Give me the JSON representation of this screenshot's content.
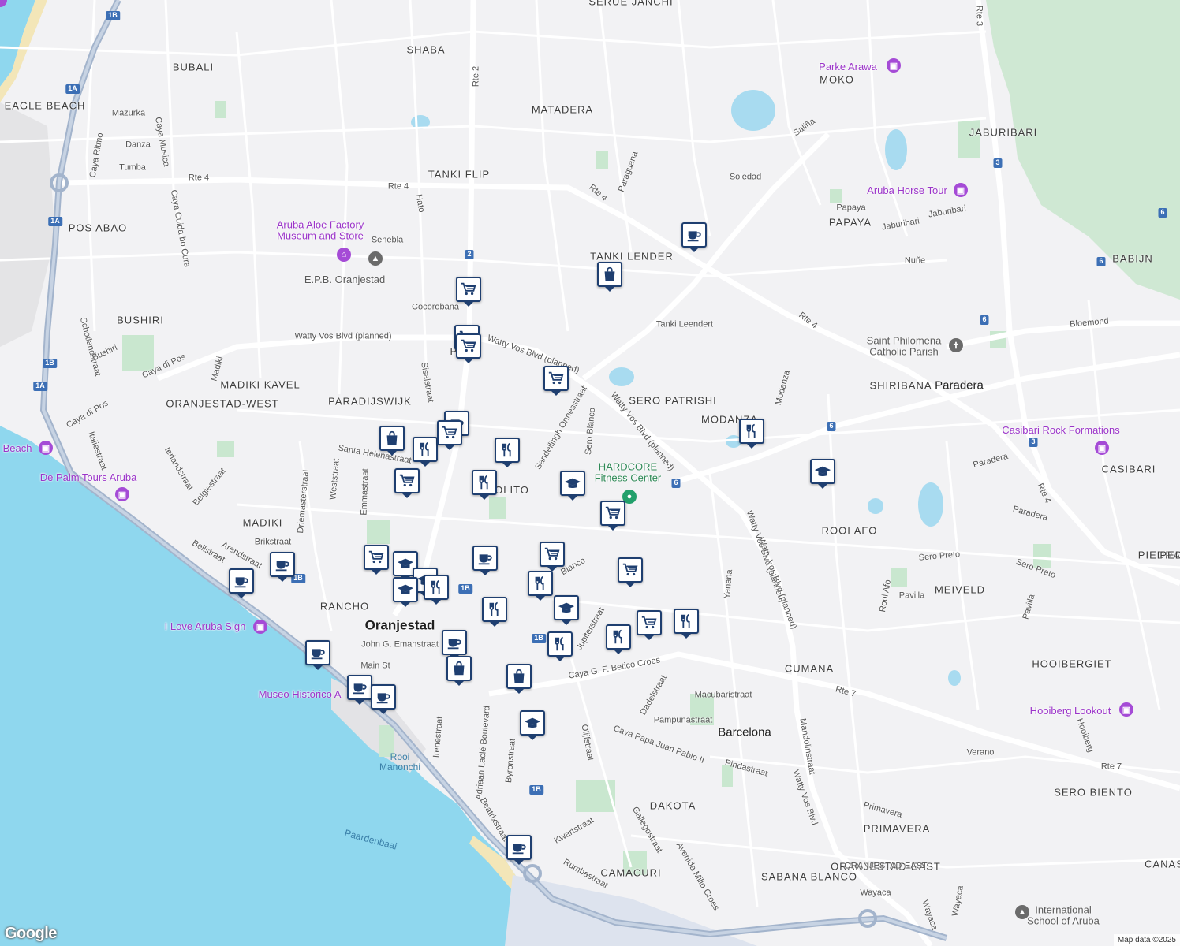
{
  "areas": [
    {
      "id": "shaba",
      "text": "SHABA"
    },
    {
      "id": "bubali",
      "text": "BUBALI"
    },
    {
      "id": "eagle-beach",
      "text": "EAGLE BEACH"
    },
    {
      "id": "matadera",
      "text": "MATADERA"
    },
    {
      "id": "moko",
      "text": "MOKO"
    },
    {
      "id": "jaburibari",
      "text": "JABURIBARI"
    },
    {
      "id": "tanki-flip",
      "text": "TANKI FLIP"
    },
    {
      "id": "pos-abao",
      "text": "POS ABAO"
    },
    {
      "id": "papaya",
      "text": "PAPAYA"
    },
    {
      "id": "tanki-lender",
      "text": "TANKI LENDER"
    },
    {
      "id": "babijn",
      "text": "BABIJN"
    },
    {
      "id": "bushiri",
      "text": "BUSHIRI"
    },
    {
      "id": "shiribana",
      "text": "SHIRIBANA"
    },
    {
      "id": "madiki-kavel",
      "text": "MADIKI KAVEL"
    },
    {
      "id": "paradijswijk",
      "text": "PARADIJSWIJK"
    },
    {
      "id": "sero-patrishi",
      "text": "SERO PATRISHI"
    },
    {
      "id": "oranjestad-west",
      "text": "ORANJESTAD-WEST"
    },
    {
      "id": "modanza",
      "text": "MODANZA"
    },
    {
      "id": "casibari",
      "text": "CASIBARI"
    },
    {
      "id": "rooi-afo",
      "text": "ROOI AFO"
    },
    {
      "id": "piedra",
      "text": "PIEDRA"
    },
    {
      "id": "madiki",
      "text": "MADIKI"
    },
    {
      "id": "meiveld",
      "text": "MEIVELD"
    },
    {
      "id": "rancho",
      "text": "RANCHO"
    },
    {
      "id": "hooibergiet",
      "text": "HOOIBERGIET"
    },
    {
      "id": "cumana",
      "text": "CUMANA"
    },
    {
      "id": "sero-biento",
      "text": "SERO BIENTO"
    },
    {
      "id": "dakota",
      "text": "DAKOTA"
    },
    {
      "id": "primavera",
      "text": "PRIMAVERA"
    },
    {
      "id": "camacuri",
      "text": "CAMACURI"
    },
    {
      "id": "sabana-blanco",
      "text": "SABANA BLANCO"
    },
    {
      "id": "oranjestad-east",
      "text": "ORANJESTAD-EAST"
    },
    {
      "id": "canas",
      "text": "CANAS"
    },
    {
      "id": "pedro-partial",
      "text": "PEDRO"
    },
    {
      "id": "serue-janchi",
      "text": "SERUE JANCHI"
    }
  ],
  "towns": [
    {
      "id": "oranjestad",
      "text": "Oranjestad"
    },
    {
      "id": "paradera",
      "text": "Paradera"
    },
    {
      "id": "barcelona",
      "text": "Barcelona"
    }
  ],
  "streets": [
    {
      "id": "mazurka",
      "text": "Mazurka"
    },
    {
      "id": "caya-ritmo",
      "text": "Caya Ritmo"
    },
    {
      "id": "caya-musica",
      "text": "Caya Musica"
    },
    {
      "id": "danza",
      "text": "Danza"
    },
    {
      "id": "tumba",
      "text": "Tumba"
    },
    {
      "id": "rte4-west",
      "text": "Rte 4"
    },
    {
      "id": "rte4-mid",
      "text": "Rte 4"
    },
    {
      "id": "rte4-ne",
      "text": "Rte 4"
    },
    {
      "id": "rte4-east",
      "text": "Rte 4"
    },
    {
      "id": "caya-cuida",
      "text": "Caya Cuida bo Cura"
    },
    {
      "id": "rte2",
      "text": "Rte 2"
    },
    {
      "id": "hato",
      "text": "Hato"
    },
    {
      "id": "senebla",
      "text": "Senebla"
    },
    {
      "id": "paraguana",
      "text": "Paraguana"
    },
    {
      "id": "salina",
      "text": "Saliña"
    },
    {
      "id": "soledad",
      "text": "Soledad"
    },
    {
      "id": "papaya-st",
      "text": "Papaya"
    },
    {
      "id": "jaburibari-st",
      "text": "Jaburibari"
    },
    {
      "id": "jaburibari-st2",
      "text": "Jaburibari"
    },
    {
      "id": "nune",
      "text": "Nuñe"
    },
    {
      "id": "rte3",
      "text": "Rte 3"
    },
    {
      "id": "cocorobana",
      "text": "Cocorobana"
    },
    {
      "id": "schotlandstraat",
      "text": "Schotlandstraat"
    },
    {
      "id": "watty-planned-1",
      "text": "Watty Vos Blvd (planned)"
    },
    {
      "id": "watty-planned-2",
      "text": "Watty Vos Blvd (planned)"
    },
    {
      "id": "watty-planned-3",
      "text": "Watty Vos Blvd (planned)"
    },
    {
      "id": "watty-planned-4",
      "text": "Watty Vos Blvd (planned)"
    },
    {
      "id": "tanki-leendert",
      "text": "Tanki Leendert"
    },
    {
      "id": "bloemond",
      "text": "Bloemond"
    },
    {
      "id": "bushiri-st",
      "text": "Bushiri"
    },
    {
      "id": "caya-di-pos",
      "text": "Caya di Pos"
    },
    {
      "id": "caya-di-pos-2",
      "text": "Caya di Pos"
    },
    {
      "id": "madiki-st",
      "text": "Madiki"
    },
    {
      "id": "sisalstraat",
      "text": "Sisalstraat"
    },
    {
      "id": "dellingh",
      "text": "Sandellingh Onnesstraat"
    },
    {
      "id": "sero-blanco-st",
      "text": "Sero Blanco"
    },
    {
      "id": "modanza-st",
      "text": "Modanza"
    },
    {
      "id": "italiestraat",
      "text": "Italiestraat"
    },
    {
      "id": "ierlandstraat",
      "text": "Ierlandstraat"
    },
    {
      "id": "belgiestraat",
      "text": "Belgiestraat"
    },
    {
      "id": "santa-helena",
      "text": "Santa Helenastraat"
    },
    {
      "id": "weststraat",
      "text": "Weststraat"
    },
    {
      "id": "emmastraat",
      "text": "Emmastraat"
    },
    {
      "id": "driemasterstraat",
      "text": "Driemasterstraat"
    },
    {
      "id": "paradera-st",
      "text": "Paradera"
    },
    {
      "id": "paradera-st2",
      "text": "Paradera"
    },
    {
      "id": "rte4-south",
      "text": "Rte 4"
    },
    {
      "id": "arendstraat",
      "text": "Arendstraat"
    },
    {
      "id": "brikstraat",
      "text": "Brikstraat"
    },
    {
      "id": "bellstraat",
      "text": "Bellstraat"
    },
    {
      "id": "sero-preto",
      "text": "Sero Preto"
    },
    {
      "id": "sero-preto-2",
      "text": "Sero Preto"
    },
    {
      "id": "rooi-afo-st",
      "text": "Rooi Afo"
    },
    {
      "id": "pavilla",
      "text": "Pavilla"
    },
    {
      "id": "pavilla-2",
      "text": "Pavilla"
    },
    {
      "id": "yanana",
      "text": "Yanana"
    },
    {
      "id": "blanco-st",
      "text": "Blanco"
    },
    {
      "id": "watty-planned-5",
      "text": "Watty Vos Blvd (planned)"
    },
    {
      "id": "john-emanstraat",
      "text": "John G. Emanstraat"
    },
    {
      "id": "jupiterstraat",
      "text": "Jupiterstraat"
    },
    {
      "id": "main-st",
      "text": "Main St"
    },
    {
      "id": "betico-croes",
      "text": "Caya G. F. Betico Croes"
    },
    {
      "id": "rte7",
      "text": "Rte 7"
    },
    {
      "id": "rte7-east",
      "text": "Rte 7"
    },
    {
      "id": "dadelstraat",
      "text": "Dadelstraat"
    },
    {
      "id": "macubaristraat",
      "text": "Macubaristraat"
    },
    {
      "id": "pampunastraat",
      "text": "Pampunastraat"
    },
    {
      "id": "irenestraat",
      "text": "Irenestraat"
    },
    {
      "id": "laclé",
      "text": "Adriaan Laclé Boulevard"
    },
    {
      "id": "byronstraat",
      "text": "Byronstraat"
    },
    {
      "id": "papa-juan",
      "text": "Caya Papa Juan Pablo II"
    },
    {
      "id": "olijfstraat",
      "text": "Olijfstraat"
    },
    {
      "id": "pindastraat",
      "text": "Pindastraat"
    },
    {
      "id": "mandolinstraat",
      "text": "Mandolinstraat"
    },
    {
      "id": "watty-vos-blvd",
      "text": "Watty Vos Blvd"
    },
    {
      "id": "verano",
      "text": "Verano"
    },
    {
      "id": "hooiberg-st",
      "text": "Hooiberg"
    },
    {
      "id": "gallegostraat",
      "text": "Gallegostraat"
    },
    {
      "id": "beatrixstraat",
      "text": "Beatrixstraat"
    },
    {
      "id": "kwartstraat",
      "text": "Kwartstraat"
    },
    {
      "id": "rumbastraat",
      "text": "Rumbastraat"
    },
    {
      "id": "milio-croes",
      "text": "Avenida Milio Croes"
    },
    {
      "id": "wayaca",
      "text": "Wayaca"
    },
    {
      "id": "wayaca-2",
      "text": "Wayaca"
    },
    {
      "id": "wayaca-3",
      "text": "Wayaca"
    },
    {
      "id": "primavera-st",
      "text": "Primavera"
    },
    {
      "id": "oranjestad-east-st",
      "text": "ORANJESTAD-EAST"
    }
  ],
  "water_labels": [
    {
      "id": "paardenbaai",
      "text": "Paardenbaai"
    }
  ],
  "pois": [
    {
      "id": "parke-arawa",
      "text": "Parke Arawa",
      "kind": "purple",
      "icon": "camera-icon"
    },
    {
      "id": "aruba-horse-tour",
      "text": "Aruba Horse Tour",
      "kind": "purple",
      "icon": "camera-icon"
    },
    {
      "id": "aloe-factory",
      "text": "Aruba Aloe Factory\nMuseum and Store",
      "kind": "purple",
      "icon": "museum-icon"
    },
    {
      "id": "epb",
      "text": "E.P.B. Oranjestad",
      "kind": "gray",
      "icon": "school-icon"
    },
    {
      "id": "saint-philomena",
      "text": "Saint Philomena\nCatholic Parish",
      "kind": "gray",
      "icon": "church-icon"
    },
    {
      "id": "casibari-rock",
      "text": "Casibari Rock Formations",
      "kind": "purple",
      "icon": "camera-icon"
    },
    {
      "id": "hardcore",
      "text": "HARDCORE\nFitness Center",
      "kind": "green",
      "icon": "gym-icon"
    },
    {
      "id": "de-palm",
      "text": "De Palm Tours Aruba",
      "kind": "purple",
      "icon": "camera-icon"
    },
    {
      "id": "eagle-beach-poi",
      "text": "Beach",
      "kind": "purple",
      "icon": "camera-icon"
    },
    {
      "id": "i-love-aruba",
      "text": "I Love Aruba Sign",
      "kind": "purple",
      "icon": "camera-icon"
    },
    {
      "id": "museo-historico",
      "text": "Museo Histórico A",
      "kind": "purple",
      "icon": "museum-icon"
    },
    {
      "id": "hooiberg-lookout",
      "text": "Hooiberg Lookout",
      "kind": "purple",
      "icon": "camera-icon"
    },
    {
      "id": "international-school",
      "text": "International\nSchool of Aruba",
      "kind": "gray",
      "icon": "school-icon"
    },
    {
      "id": "rooi-manonchi",
      "text": "Rooi\nManonchi",
      "kind": "water",
      "icon": ""
    },
    {
      "id": "polito",
      "text": "OLITO",
      "kind": "area",
      "icon": ""
    },
    {
      "id": "pedro-n",
      "text": "P  N",
      "kind": "area",
      "icon": ""
    }
  ],
  "route_shields": [
    {
      "id": "s1",
      "text": "1B"
    },
    {
      "id": "s2",
      "text": "1A"
    },
    {
      "id": "s3",
      "text": "1A"
    },
    {
      "id": "s4",
      "text": "1B"
    },
    {
      "id": "s5",
      "text": "1A"
    },
    {
      "id": "s6",
      "text": "2"
    },
    {
      "id": "s7",
      "text": "3"
    },
    {
      "id": "s8",
      "text": "6"
    },
    {
      "id": "s9",
      "text": "6"
    },
    {
      "id": "s10",
      "text": "6"
    },
    {
      "id": "s11",
      "text": "6"
    },
    {
      "id": "s12",
      "text": "6"
    },
    {
      "id": "s13",
      "text": "3"
    },
    {
      "id": "s14",
      "text": "1B"
    },
    {
      "id": "s15",
      "text": "1B"
    },
    {
      "id": "s16",
      "text": "1B"
    },
    {
      "id": "s17",
      "text": "1B"
    }
  ],
  "markers": [
    {
      "id": "m1",
      "type": "cafe"
    },
    {
      "id": "m2",
      "type": "shopping-bag"
    },
    {
      "id": "m3",
      "type": "cart"
    },
    {
      "id": "m4",
      "type": "cart"
    },
    {
      "id": "m5",
      "type": "cart"
    },
    {
      "id": "m6",
      "type": "cart"
    },
    {
      "id": "m7",
      "type": "cafe"
    },
    {
      "id": "m8",
      "type": "shopping-bag"
    },
    {
      "id": "m9",
      "type": "restaurant"
    },
    {
      "id": "m10",
      "type": "cart"
    },
    {
      "id": "m11",
      "type": "restaurant"
    },
    {
      "id": "m12",
      "type": "restaurant"
    },
    {
      "id": "m13",
      "type": "cart"
    },
    {
      "id": "m14",
      "type": "restaurant"
    },
    {
      "id": "m15",
      "type": "school"
    },
    {
      "id": "m16",
      "type": "cart"
    },
    {
      "id": "m17",
      "type": "school"
    },
    {
      "id": "m18",
      "type": "cafe"
    },
    {
      "id": "m19",
      "type": "cafe"
    },
    {
      "id": "m20",
      "type": "cart"
    },
    {
      "id": "m21",
      "type": "school"
    },
    {
      "id": "m22",
      "type": "cafe"
    },
    {
      "id": "m23",
      "type": "school"
    },
    {
      "id": "m24",
      "type": "school"
    },
    {
      "id": "m25",
      "type": "cart"
    },
    {
      "id": "m26",
      "type": "restaurant"
    },
    {
      "id": "m27",
      "type": "cart"
    },
    {
      "id": "m28",
      "type": "restaurant"
    },
    {
      "id": "m29",
      "type": "school"
    },
    {
      "id": "m30",
      "type": "cart"
    },
    {
      "id": "m31",
      "type": "restaurant"
    },
    {
      "id": "m32",
      "type": "restaurant"
    },
    {
      "id": "m33",
      "type": "restaurant"
    },
    {
      "id": "m34",
      "type": "cafe"
    },
    {
      "id": "m35",
      "type": "cafe"
    },
    {
      "id": "m36",
      "type": "shopping-bag"
    },
    {
      "id": "m37",
      "type": "shopping-bag"
    },
    {
      "id": "m38",
      "type": "cafe"
    },
    {
      "id": "m39",
      "type": "cafe"
    },
    {
      "id": "m40",
      "type": "school"
    },
    {
      "id": "m41",
      "type": "cafe"
    },
    {
      "id": "m42",
      "type": "restaurant"
    }
  ],
  "attribution": {
    "logo": "Google",
    "data": "Map data ©2025"
  }
}
